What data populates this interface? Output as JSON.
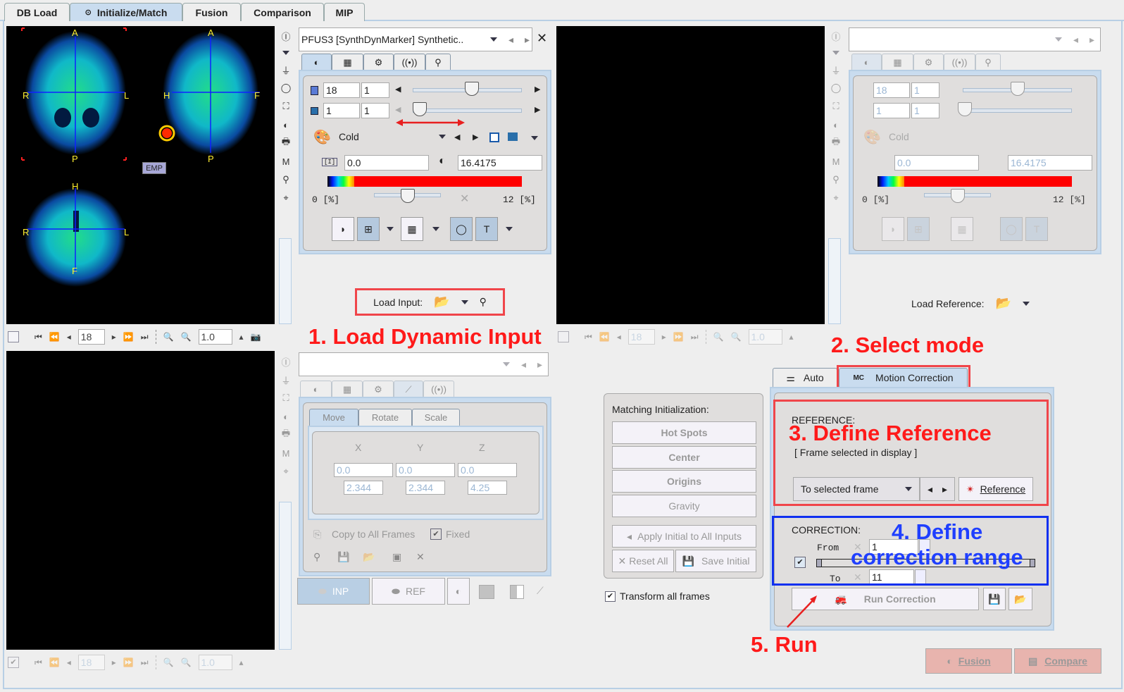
{
  "tabs": [
    {
      "label": "DB Load",
      "active": false
    },
    {
      "label": "Initialize/Match",
      "active": true,
      "icon": "radio-icon"
    },
    {
      "label": "Fusion",
      "active": false
    },
    {
      "label": "Comparison",
      "active": false
    },
    {
      "label": "MIP",
      "active": false
    }
  ],
  "input_viewer": {
    "labels": {
      "a1": "A",
      "p1": "P",
      "r1": "R",
      "l1": "L",
      "a2": "A",
      "p2": "P",
      "h2": "H",
      "f2": "F",
      "h3": "H",
      "f3": "F",
      "r3": "R",
      "l3": "L"
    },
    "emp_badge": "EMP",
    "frame": "18",
    "zoom": "1.0"
  },
  "input_panel": {
    "series_select": "PFUS3 [SynthDynMarker] Synthetic..",
    "close_label": "✕",
    "frame_value": "18",
    "frame_step": "1",
    "slice_value": "1",
    "slice_step": "1",
    "frame_slider_fraction": 0.55,
    "slice_slider_fraction": 0.0,
    "colormap": "Cold",
    "min_value": "0.0",
    "max_value": "16.4175",
    "range_left": "0  [%]",
    "range_right": "12  [%]",
    "threshold_slider_fraction": 0.5
  },
  "load_input_label": "Load Input:",
  "load_reference_label": "Load Reference:",
  "reference_panel": {
    "frame_value": "18",
    "frame_step": "1",
    "slice_value": "1",
    "slice_step": "1",
    "colormap": "Cold",
    "min_value": "0.0",
    "max_value": "16.4175",
    "range_left": "0  [%]",
    "range_right": "12  [%]",
    "frame": "18",
    "zoom": "1.0"
  },
  "fusion_viewer": {
    "frame": "18",
    "zoom": "1.0"
  },
  "transform_panel": {
    "tabs": [
      "Move",
      "Rotate",
      "Scale"
    ],
    "axes": [
      "X",
      "Y",
      "Z"
    ],
    "values": [
      "0.0",
      "0.0",
      "0.0"
    ],
    "steps": [
      "2.344",
      "2.344",
      "4.25"
    ],
    "copy_label": "Copy to All Frames",
    "fixed_label": "Fixed",
    "inp_label": "INP",
    "ref_label": "REF"
  },
  "matching": {
    "title": "Matching Initialization:",
    "buttons": [
      "Hot Spots",
      "Center",
      "Origins",
      "Gravity"
    ],
    "apply_label": "Apply Initial to All Inputs",
    "reset_label": "Reset All",
    "save_label": "Save Initial",
    "transform_all_label": "Transform all frames",
    "transform_all_checked": true
  },
  "mode_tabs": [
    {
      "label": "Auto",
      "active": false
    },
    {
      "label": "Motion Correction",
      "active": true
    }
  ],
  "motion": {
    "reference_title": "REFERENCE:",
    "reference_hint": "[ Frame selected in display ]",
    "reference_select": "To selected frame",
    "reference_button": "Reference",
    "correction_title": "CORRECTION:",
    "from_label": "From",
    "to_label": "To",
    "from_value": "1",
    "to_value": "11",
    "range_enabled": true,
    "run_label": "Run Correction"
  },
  "bottom_buttons": {
    "fusion": "Fusion",
    "compare": "Compare"
  },
  "annotations": {
    "step1": "1. Load Dynamic Input",
    "step2": "2. Select mode",
    "step3": "3. Define Reference",
    "step4a": "4. Define",
    "step4b": "correction range",
    "step5": "5. Run"
  }
}
